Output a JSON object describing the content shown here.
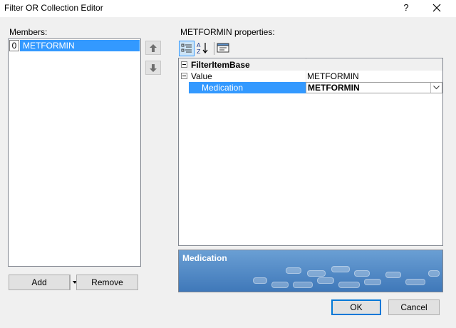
{
  "window": {
    "title": "Filter OR Collection Editor",
    "help_glyph": "?"
  },
  "members": {
    "label": "Members:",
    "items": [
      {
        "index": "0",
        "name": "METFORMIN"
      }
    ],
    "add_label": "Add",
    "remove_label": "Remove"
  },
  "properties": {
    "header": "METFORMIN properties:",
    "toolbar": [
      "categorized-icon",
      "alphabetical-sort-icon",
      "property-pages-icon"
    ],
    "category": "FilterItemBase",
    "rows": [
      {
        "name": "Value",
        "value": "METFORMIN"
      },
      {
        "name": "Medication",
        "value": "METFORMIN"
      }
    ],
    "help_title": "Medication"
  },
  "dialog": {
    "ok_label": "OK",
    "cancel_label": "Cancel"
  },
  "colors": {
    "selection": "#3399ff",
    "help_bg": "#4a82c3",
    "accent_border": "#0078d7"
  }
}
